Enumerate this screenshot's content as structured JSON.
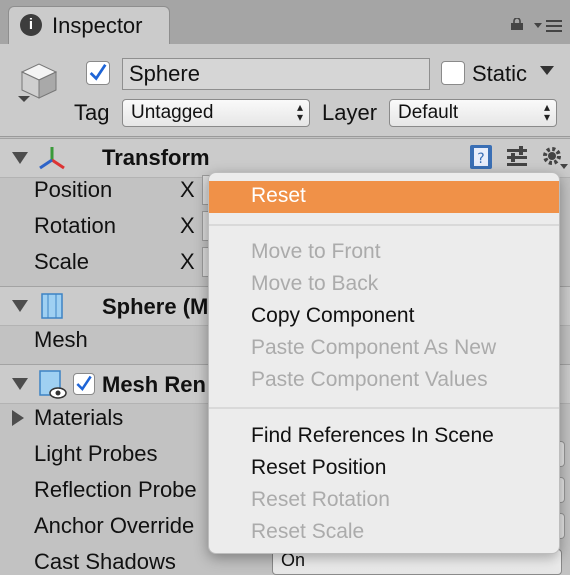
{
  "tab": {
    "title": "Inspector",
    "info_glyph": "i"
  },
  "header": {
    "object_name": "Sphere",
    "static_label": "Static",
    "tag_label": "Tag",
    "tag_value": "Untagged",
    "layer_label": "Layer",
    "layer_value": "Default"
  },
  "transform": {
    "title": "Transform",
    "rows": [
      {
        "label": "Position",
        "axis": "X"
      },
      {
        "label": "Rotation",
        "axis": "X"
      },
      {
        "label": "Scale",
        "axis": "X"
      }
    ]
  },
  "mesh_filter": {
    "title": "Sphere (M",
    "row": "Mesh"
  },
  "mesh_renderer": {
    "title": "Mesh Ren",
    "rows": [
      "Materials",
      "Light Probes",
      "Reflection Probe",
      "Anchor Override",
      "Cast Shadows"
    ],
    "cast_shadows_value": "On"
  },
  "context_menu": {
    "items": [
      {
        "label": "Reset",
        "state": "highlighted"
      },
      {
        "label": "Move to Front",
        "state": "disabled"
      },
      {
        "label": "Move to Back",
        "state": "disabled"
      },
      {
        "label": "Copy Component",
        "state": "enabled"
      },
      {
        "label": "Paste Component As New",
        "state": "disabled"
      },
      {
        "label": "Paste Component Values",
        "state": "disabled"
      },
      {
        "label": "Find References In Scene",
        "state": "enabled"
      },
      {
        "label": "Reset Position",
        "state": "enabled"
      },
      {
        "label": "Reset Rotation",
        "state": "disabled"
      },
      {
        "label": "Reset Scale",
        "state": "disabled"
      }
    ]
  },
  "colors": {
    "highlight": "#f09148",
    "panel": "#c2c2c2",
    "check_blue": "#1e64d6"
  },
  "icons": [
    "info-icon",
    "lock-icon",
    "tab-menu-icon",
    "gameobject-cube-icon",
    "transform-axes-icon",
    "help-book-icon",
    "presets-icon",
    "gear-icon",
    "mesh-filter-icon",
    "mesh-renderer-icon"
  ]
}
